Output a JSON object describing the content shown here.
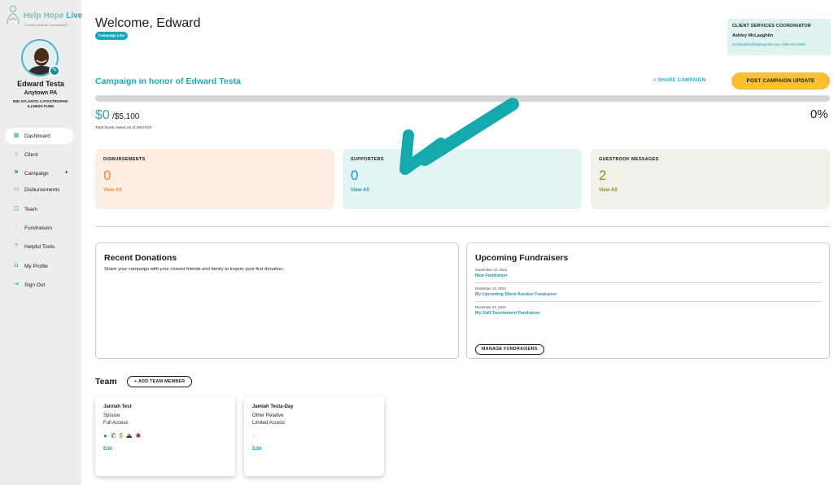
{
  "brand": {
    "logo_main": "Help Hope",
    "logo_accent": "Live",
    "tagline": "Trusted Medical Fundraising®"
  },
  "profile": {
    "name": "Edward Testa",
    "location": "Anytown PA",
    "fund": "MID-ATLANTIC CATASTROPHIC ILLNESS FUND"
  },
  "nav": [
    {
      "label": "Dashboard",
      "icon": "dashboard-icon"
    },
    {
      "label": "Client",
      "icon": "person-icon"
    },
    {
      "label": "Campaign",
      "icon": "campaign-icon",
      "expand": "+"
    },
    {
      "label": "Disbursements",
      "icon": "disbursements-icon"
    },
    {
      "label": "Team",
      "icon": "team-icon"
    },
    {
      "label": "Fundraisers",
      "icon": "fundraisers-icon"
    },
    {
      "label": "Helpful Tools",
      "icon": "help-icon"
    },
    {
      "label": "My Profile",
      "icon": "profile-icon"
    },
    {
      "label": "Sign Out",
      "icon": "sign-out-icon"
    }
  ],
  "header": {
    "welcome": "Welcome, Edward",
    "badge": "Campaign Live"
  },
  "coordinator": {
    "title": "CLIENT SERVICES COORDINATOR",
    "name": "Ashley McLaughlin",
    "contact": "amclaughlin@helphopelive.org • (800) 642-8399"
  },
  "campaign": {
    "title": "Campaign in honor of Edward Testa",
    "share_label": "SHARE CAMPAIGN",
    "post_label": "POST CAMPAIGN UPDATE",
    "raised": "$0",
    "goal": "/$5,100",
    "note": "Total funds raised as of 08/27/24",
    "percent_label": "0%",
    "progress_fraction": 0
  },
  "stats": [
    {
      "title": "DISBURSEMENTS",
      "value": "0",
      "link": "View All",
      "bg": "#fdeee3",
      "accent": "#ef8a2f"
    },
    {
      "title": "SUPPORTERS",
      "value": "0",
      "link": "View All",
      "bg": "#e2f4f3",
      "accent": "#1a9bab"
    },
    {
      "title": "GUESTBOOK MESSAGES",
      "value": "2",
      "link": "View All",
      "bg": "#f1f1e8",
      "accent": "#8a8c25"
    }
  ],
  "recent_donations": {
    "title": "Recent Donations",
    "description": "Share your campaign with your closest friends and family to inspire your first donation."
  },
  "upcoming": {
    "title": "Upcoming Fundraisers",
    "items": [
      {
        "date": "September 10, 2024",
        "name": "New Fundraiser"
      },
      {
        "date": "November 13, 2024",
        "name": "My Upcoming Silent Auction Fundraiser"
      },
      {
        "date": "December 02, 2024",
        "name": "My Golf Tournament Fundraiser"
      }
    ],
    "manage_label": "MANAGE FUNDRAISERS"
  },
  "team": {
    "title": "Team",
    "add_label": "+ ADD TEAM MEMBER",
    "members": [
      {
        "name": "Jannah Test",
        "role": "Spouse",
        "access": "Full Access",
        "edit": "Edit"
      },
      {
        "name": "Jamiah Testa-Day",
        "role": "Other Relative",
        "access": "Limited Access",
        "edit": "Edit"
      }
    ]
  },
  "colors": {
    "brand_teal": "#23a9b6",
    "cta_yellow": "#f9bf2e",
    "sidebar_bg": "#ededed",
    "arrow_teal": "#14a9ad"
  }
}
